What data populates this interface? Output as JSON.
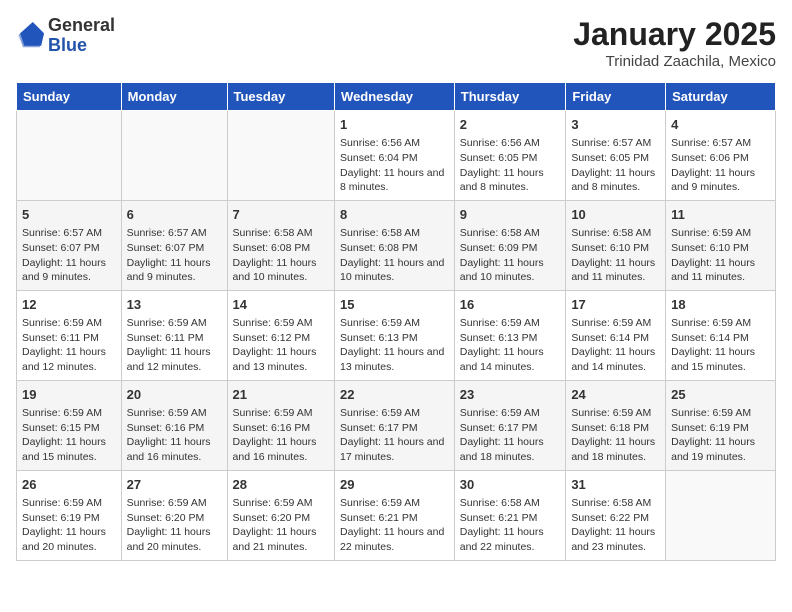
{
  "header": {
    "logo_general": "General",
    "logo_blue": "Blue",
    "title": "January 2025",
    "subtitle": "Trinidad Zaachila, Mexico"
  },
  "days_of_week": [
    "Sunday",
    "Monday",
    "Tuesday",
    "Wednesday",
    "Thursday",
    "Friday",
    "Saturday"
  ],
  "weeks": [
    [
      {
        "day": "",
        "info": ""
      },
      {
        "day": "",
        "info": ""
      },
      {
        "day": "",
        "info": ""
      },
      {
        "day": "1",
        "info": "Sunrise: 6:56 AM\nSunset: 6:04 PM\nDaylight: 11 hours and 8 minutes."
      },
      {
        "day": "2",
        "info": "Sunrise: 6:56 AM\nSunset: 6:05 PM\nDaylight: 11 hours and 8 minutes."
      },
      {
        "day": "3",
        "info": "Sunrise: 6:57 AM\nSunset: 6:05 PM\nDaylight: 11 hours and 8 minutes."
      },
      {
        "day": "4",
        "info": "Sunrise: 6:57 AM\nSunset: 6:06 PM\nDaylight: 11 hours and 9 minutes."
      }
    ],
    [
      {
        "day": "5",
        "info": "Sunrise: 6:57 AM\nSunset: 6:07 PM\nDaylight: 11 hours and 9 minutes."
      },
      {
        "day": "6",
        "info": "Sunrise: 6:57 AM\nSunset: 6:07 PM\nDaylight: 11 hours and 9 minutes."
      },
      {
        "day": "7",
        "info": "Sunrise: 6:58 AM\nSunset: 6:08 PM\nDaylight: 11 hours and 10 minutes."
      },
      {
        "day": "8",
        "info": "Sunrise: 6:58 AM\nSunset: 6:08 PM\nDaylight: 11 hours and 10 minutes."
      },
      {
        "day": "9",
        "info": "Sunrise: 6:58 AM\nSunset: 6:09 PM\nDaylight: 11 hours and 10 minutes."
      },
      {
        "day": "10",
        "info": "Sunrise: 6:58 AM\nSunset: 6:10 PM\nDaylight: 11 hours and 11 minutes."
      },
      {
        "day": "11",
        "info": "Sunrise: 6:59 AM\nSunset: 6:10 PM\nDaylight: 11 hours and 11 minutes."
      }
    ],
    [
      {
        "day": "12",
        "info": "Sunrise: 6:59 AM\nSunset: 6:11 PM\nDaylight: 11 hours and 12 minutes."
      },
      {
        "day": "13",
        "info": "Sunrise: 6:59 AM\nSunset: 6:11 PM\nDaylight: 11 hours and 12 minutes."
      },
      {
        "day": "14",
        "info": "Sunrise: 6:59 AM\nSunset: 6:12 PM\nDaylight: 11 hours and 13 minutes."
      },
      {
        "day": "15",
        "info": "Sunrise: 6:59 AM\nSunset: 6:13 PM\nDaylight: 11 hours and 13 minutes."
      },
      {
        "day": "16",
        "info": "Sunrise: 6:59 AM\nSunset: 6:13 PM\nDaylight: 11 hours and 14 minutes."
      },
      {
        "day": "17",
        "info": "Sunrise: 6:59 AM\nSunset: 6:14 PM\nDaylight: 11 hours and 14 minutes."
      },
      {
        "day": "18",
        "info": "Sunrise: 6:59 AM\nSunset: 6:14 PM\nDaylight: 11 hours and 15 minutes."
      }
    ],
    [
      {
        "day": "19",
        "info": "Sunrise: 6:59 AM\nSunset: 6:15 PM\nDaylight: 11 hours and 15 minutes."
      },
      {
        "day": "20",
        "info": "Sunrise: 6:59 AM\nSunset: 6:16 PM\nDaylight: 11 hours and 16 minutes."
      },
      {
        "day": "21",
        "info": "Sunrise: 6:59 AM\nSunset: 6:16 PM\nDaylight: 11 hours and 16 minutes."
      },
      {
        "day": "22",
        "info": "Sunrise: 6:59 AM\nSunset: 6:17 PM\nDaylight: 11 hours and 17 minutes."
      },
      {
        "day": "23",
        "info": "Sunrise: 6:59 AM\nSunset: 6:17 PM\nDaylight: 11 hours and 18 minutes."
      },
      {
        "day": "24",
        "info": "Sunrise: 6:59 AM\nSunset: 6:18 PM\nDaylight: 11 hours and 18 minutes."
      },
      {
        "day": "25",
        "info": "Sunrise: 6:59 AM\nSunset: 6:19 PM\nDaylight: 11 hours and 19 minutes."
      }
    ],
    [
      {
        "day": "26",
        "info": "Sunrise: 6:59 AM\nSunset: 6:19 PM\nDaylight: 11 hours and 20 minutes."
      },
      {
        "day": "27",
        "info": "Sunrise: 6:59 AM\nSunset: 6:20 PM\nDaylight: 11 hours and 20 minutes."
      },
      {
        "day": "28",
        "info": "Sunrise: 6:59 AM\nSunset: 6:20 PM\nDaylight: 11 hours and 21 minutes."
      },
      {
        "day": "29",
        "info": "Sunrise: 6:59 AM\nSunset: 6:21 PM\nDaylight: 11 hours and 22 minutes."
      },
      {
        "day": "30",
        "info": "Sunrise: 6:58 AM\nSunset: 6:21 PM\nDaylight: 11 hours and 22 minutes."
      },
      {
        "day": "31",
        "info": "Sunrise: 6:58 AM\nSunset: 6:22 PM\nDaylight: 11 hours and 23 minutes."
      },
      {
        "day": "",
        "info": ""
      }
    ]
  ]
}
